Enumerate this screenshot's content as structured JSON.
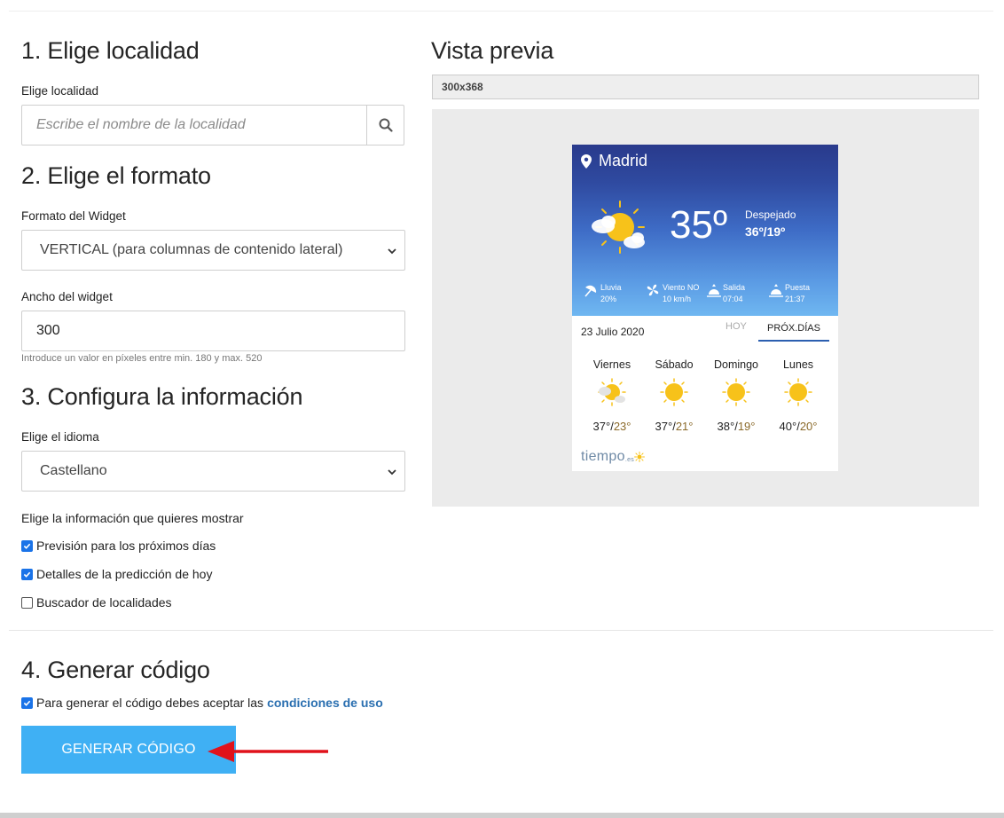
{
  "section1": {
    "title": "1. Elige localidad",
    "label": "Elige localidad",
    "search_placeholder": "Escribe el nombre de la localidad"
  },
  "section2": {
    "title": "2. Elige el formato",
    "format_label": "Formato del Widget",
    "format_value": "VERTICAL (para columnas de contenido lateral)",
    "width_label": "Ancho del widget",
    "width_value": "300",
    "width_hint": "Introduce un valor en píxeles entre min. 180 y max. 520"
  },
  "section3": {
    "title": "3. Configura la información",
    "language_label": "Elige el idioma",
    "language_value": "Castellano",
    "info_label": "Elige la información que quieres mostrar",
    "options": [
      {
        "label": "Previsión para los próximos días",
        "checked": true
      },
      {
        "label": "Detalles de la predicción de hoy",
        "checked": true
      },
      {
        "label": "Buscador de localidades",
        "checked": false
      }
    ]
  },
  "section4": {
    "title": "4. Generar código",
    "terms_text": "Para generar el código debes aceptar las",
    "terms_link": "condiciones de uso",
    "terms_checked": true,
    "button_label": "GENERAR CÓDIGO"
  },
  "preview": {
    "title": "Vista previa",
    "size": "300x368",
    "widget": {
      "city": "Madrid",
      "temp": "35º",
      "condition": "Despejado",
      "range": "36º/19º",
      "details": [
        {
          "icon": "umbrella-icon",
          "label": "Lluvia",
          "value": "20%"
        },
        {
          "icon": "wind-icon",
          "label": "Viento NO",
          "value": "10 km/h"
        },
        {
          "icon": "sunrise-icon",
          "label": "Salida",
          "value": "07:04"
        },
        {
          "icon": "sunset-icon",
          "label": "Puesta",
          "value": "21:37"
        }
      ],
      "date": "23 Julio 2020",
      "tab_today": "HOY",
      "tab_next": "PRÓX.DÍAS",
      "days": [
        {
          "name": "Viernes",
          "max": "37°",
          "min": "23°",
          "icon": "sun-cloud-icon"
        },
        {
          "name": "Sábado",
          "max": "37°",
          "min": "21°",
          "icon": "sun-icon"
        },
        {
          "name": "Domingo",
          "max": "38°",
          "min": "19°",
          "icon": "sun-icon"
        },
        {
          "name": "Lunes",
          "max": "40°",
          "min": "20°",
          "icon": "sun-icon"
        }
      ],
      "logo": "tiempo",
      "logo_suffix": ".es"
    }
  },
  "colors": {
    "button": "#3fb0f4",
    "link": "#2a6fb0",
    "arrow": "#e0121b",
    "sun": "#f7c21a"
  }
}
